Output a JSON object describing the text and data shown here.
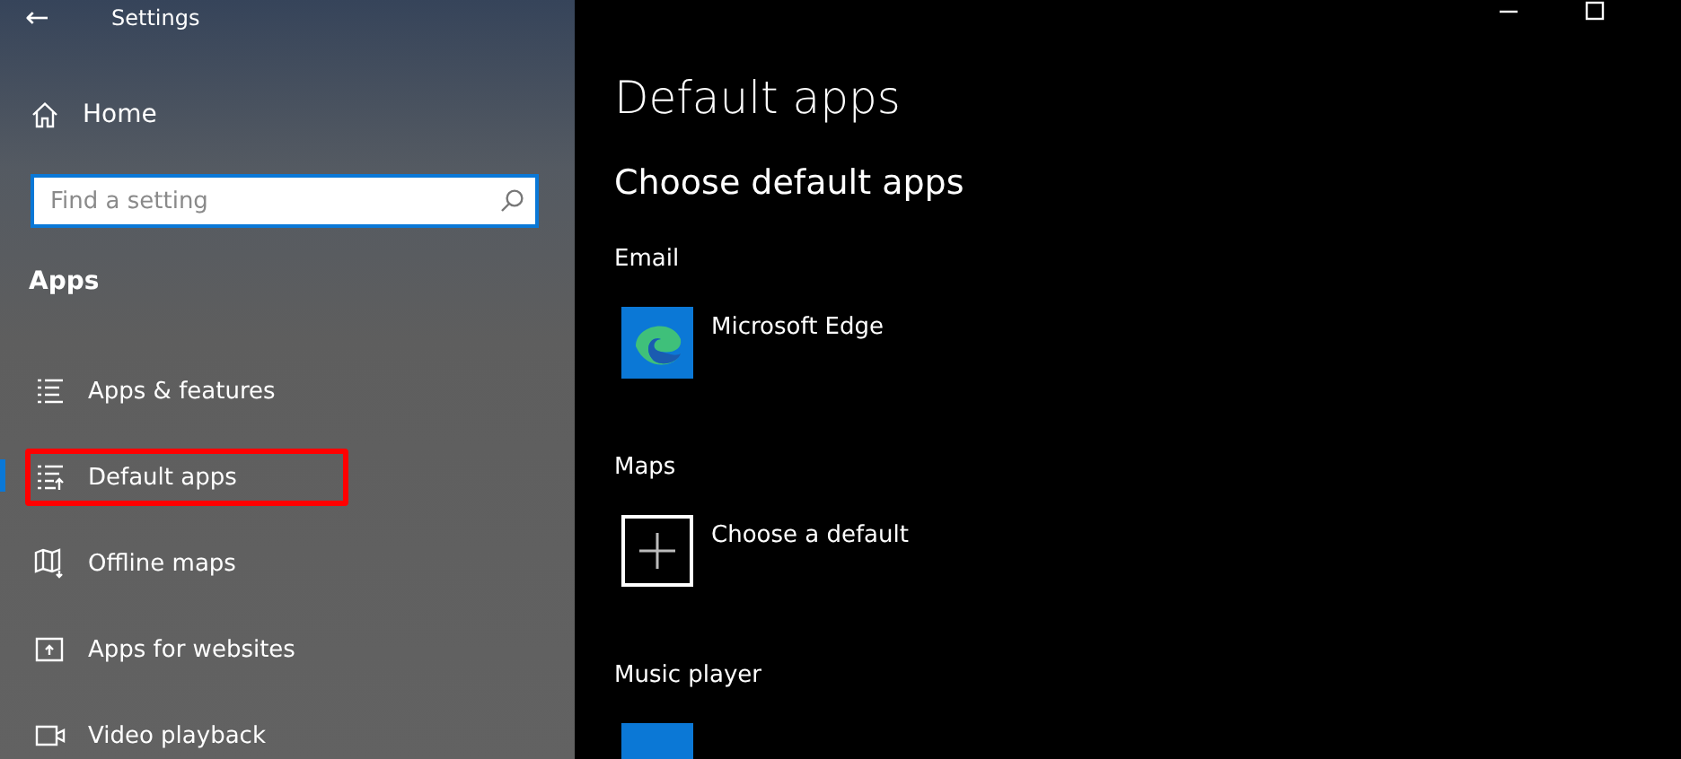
{
  "window": {
    "title": "Settings",
    "back": "←"
  },
  "sidebar": {
    "home": "Home",
    "search": {
      "placeholder": "Find a setting"
    },
    "group": "Apps",
    "items": [
      {
        "label": "Apps & features",
        "kind": "list",
        "selected": false,
        "highlighted": false
      },
      {
        "label": "Default apps",
        "kind": "default",
        "selected": true,
        "highlighted": true
      },
      {
        "label": "Offline maps",
        "kind": "map",
        "selected": false,
        "highlighted": false
      },
      {
        "label": "Apps for websites",
        "kind": "web",
        "selected": false,
        "highlighted": false
      },
      {
        "label": "Video playback",
        "kind": "video",
        "selected": false,
        "highlighted": false
      }
    ]
  },
  "main": {
    "title": "Default apps",
    "subtitle": "Choose default apps",
    "sections": [
      {
        "label": "Email",
        "app": {
          "kind": "edge",
          "name": "Microsoft Edge"
        }
      },
      {
        "label": "Maps",
        "app": {
          "kind": "choose",
          "name": "Choose a default"
        }
      },
      {
        "label": "Music player",
        "app": {
          "kind": "tile"
        }
      }
    ]
  }
}
